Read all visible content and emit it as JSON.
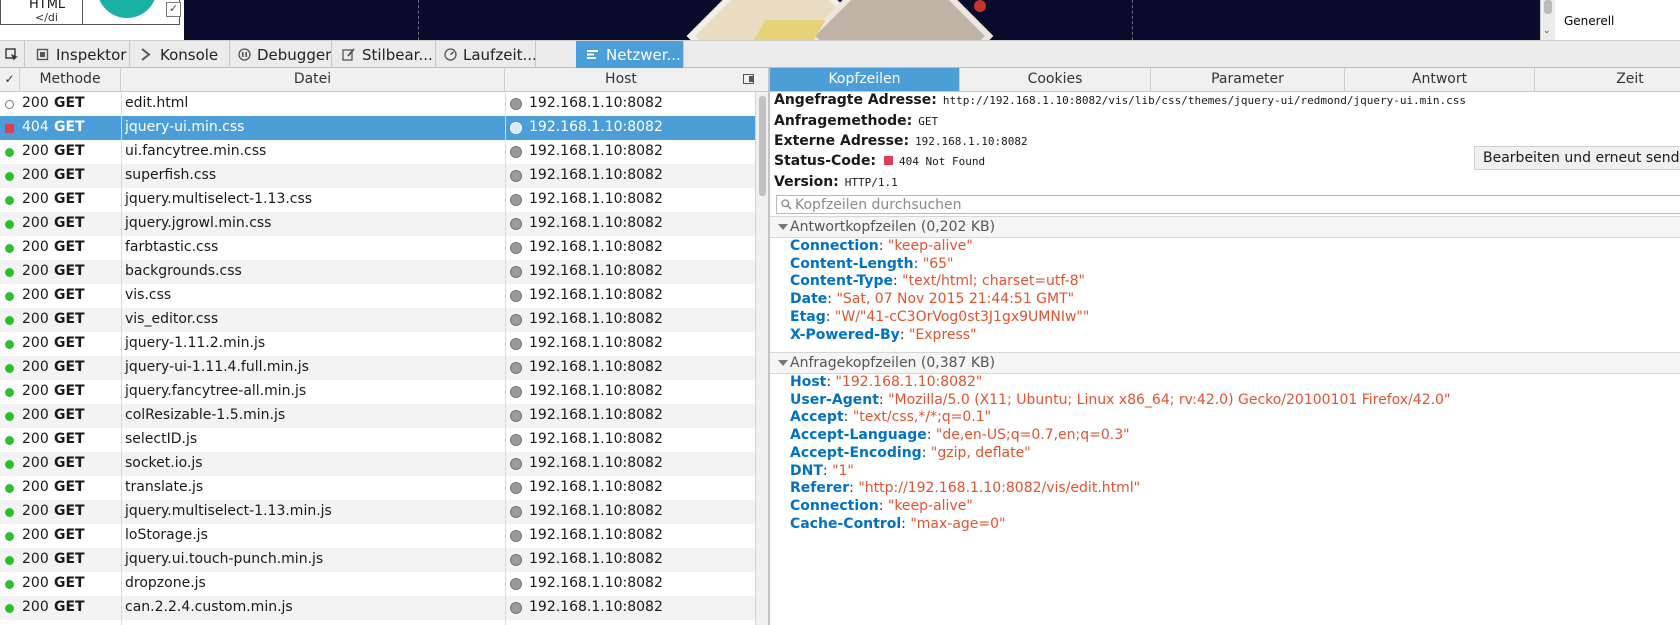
{
  "page_strip": {
    "html_box_line1": "HTML",
    "html_box_line2": "</di",
    "checkbox_mark": "✓",
    "scroll_arrow": "⌄",
    "generell_label": "Generell"
  },
  "toolbar": {
    "tabs": [
      {
        "label": "Inspektor",
        "icon": "inspector-icon"
      },
      {
        "label": "Konsole",
        "icon": "console-icon"
      },
      {
        "label": "Debugger",
        "icon": "debugger-icon"
      },
      {
        "label": "Stilbear...",
        "icon": "style-editor-icon"
      },
      {
        "label": "Laufzeit...",
        "icon": "performance-icon"
      },
      {
        "label": "Netzwer...",
        "icon": "network-icon"
      }
    ],
    "active_tab": "Netzwer..."
  },
  "requests": {
    "columns": {
      "check": "✓",
      "method": "Methode",
      "file": "Datei",
      "host": "Host"
    },
    "rows": [
      {
        "status": "200",
        "method": "GET",
        "file": "edit.html",
        "host": "192.168.1.10:8082",
        "state": "pending"
      },
      {
        "status": "404",
        "method": "GET",
        "file": "jquery-ui.min.css",
        "host": "192.168.1.10:8082",
        "state": "error"
      },
      {
        "status": "200",
        "method": "GET",
        "file": "ui.fancytree.min.css",
        "host": "192.168.1.10:8082",
        "state": "ok"
      },
      {
        "status": "200",
        "method": "GET",
        "file": "superfish.css",
        "host": "192.168.1.10:8082",
        "state": "ok"
      },
      {
        "status": "200",
        "method": "GET",
        "file": "jquery.multiselect-1.13.css",
        "host": "192.168.1.10:8082",
        "state": "ok"
      },
      {
        "status": "200",
        "method": "GET",
        "file": "jquery.jgrowl.min.css",
        "host": "192.168.1.10:8082",
        "state": "ok"
      },
      {
        "status": "200",
        "method": "GET",
        "file": "farbtastic.css",
        "host": "192.168.1.10:8082",
        "state": "ok"
      },
      {
        "status": "200",
        "method": "GET",
        "file": "backgrounds.css",
        "host": "192.168.1.10:8082",
        "state": "ok"
      },
      {
        "status": "200",
        "method": "GET",
        "file": "vis.css",
        "host": "192.168.1.10:8082",
        "state": "ok"
      },
      {
        "status": "200",
        "method": "GET",
        "file": "vis_editor.css",
        "host": "192.168.1.10:8082",
        "state": "ok"
      },
      {
        "status": "200",
        "method": "GET",
        "file": "jquery-1.11.2.min.js",
        "host": "192.168.1.10:8082",
        "state": "ok"
      },
      {
        "status": "200",
        "method": "GET",
        "file": "jquery-ui-1.11.4.full.min.js",
        "host": "192.168.1.10:8082",
        "state": "ok"
      },
      {
        "status": "200",
        "method": "GET",
        "file": "jquery.fancytree-all.min.js",
        "host": "192.168.1.10:8082",
        "state": "ok"
      },
      {
        "status": "200",
        "method": "GET",
        "file": "colResizable-1.5.min.js",
        "host": "192.168.1.10:8082",
        "state": "ok"
      },
      {
        "status": "200",
        "method": "GET",
        "file": "selectID.js",
        "host": "192.168.1.10:8082",
        "state": "ok"
      },
      {
        "status": "200",
        "method": "GET",
        "file": "socket.io.js",
        "host": "192.168.1.10:8082",
        "state": "ok"
      },
      {
        "status": "200",
        "method": "GET",
        "file": "translate.js",
        "host": "192.168.1.10:8082",
        "state": "ok"
      },
      {
        "status": "200",
        "method": "GET",
        "file": "jquery.multiselect-1.13.min.js",
        "host": "192.168.1.10:8082",
        "state": "ok"
      },
      {
        "status": "200",
        "method": "GET",
        "file": "loStorage.js",
        "host": "192.168.1.10:8082",
        "state": "ok"
      },
      {
        "status": "200",
        "method": "GET",
        "file": "jquery.ui.touch-punch.min.js",
        "host": "192.168.1.10:8082",
        "state": "ok"
      },
      {
        "status": "200",
        "method": "GET",
        "file": "dropzone.js",
        "host": "192.168.1.10:8082",
        "state": "ok"
      },
      {
        "status": "200",
        "method": "GET",
        "file": "can.2.2.4.custom.min.js",
        "host": "192.168.1.10:8082",
        "state": "ok"
      }
    ],
    "selected_index": 1
  },
  "details": {
    "tabs": [
      "Kopfzeilen",
      "Cookies",
      "Parameter",
      "Antwort",
      "Zeit"
    ],
    "active_tab": "Kopfzeilen",
    "summary": {
      "url_label": "Angefragte Adresse:",
      "url_value": "http://192.168.1.10:8082/vis/lib/css/themes/jquery-ui/redmond/jquery-ui.min.css",
      "method_label": "Anfragemethode:",
      "method_value": "GET",
      "remote_label": "Externe Adresse:",
      "remote_value": "192.168.1.10:8082",
      "status_label": "Status-Code:",
      "status_value": "404 Not Found",
      "version_label": "Version:",
      "version_value": "HTTP/1.1"
    },
    "edit_resend_label": "Bearbeiten und erneut senden",
    "filter_placeholder": "Kopfzeilen durchsuchen",
    "response_section": "Antwortkopfzeilen (0,202 KB)",
    "response_headers": [
      {
        "name": "Connection",
        "value": "\"keep-alive\""
      },
      {
        "name": "Content-Length",
        "value": "\"65\""
      },
      {
        "name": "Content-Type",
        "value": "\"text/html; charset=utf-8\""
      },
      {
        "name": "Date",
        "value": "\"Sat, 07 Nov 2015 21:44:51 GMT\""
      },
      {
        "name": "Etag",
        "value": "\"W/\"41-cC3OrVog0st3J1gx9UMNIw\"\""
      },
      {
        "name": "X-Powered-By",
        "value": "\"Express\""
      }
    ],
    "request_section": "Anfragekopfzeilen (0,387 KB)",
    "request_headers": [
      {
        "name": "Host",
        "value": "\"192.168.1.10:8082\""
      },
      {
        "name": "User-Agent",
        "value": "\"Mozilla/5.0 (X11; Ubuntu; Linux x86_64; rv:42.0) Gecko/20100101 Firefox/42.0\""
      },
      {
        "name": "Accept",
        "value": "\"text/css,*/*;q=0.1\""
      },
      {
        "name": "Accept-Language",
        "value": "\"de,en-US;q=0.7,en;q=0.3\""
      },
      {
        "name": "Accept-Encoding",
        "value": "\"gzip, deflate\""
      },
      {
        "name": "DNT",
        "value": "\"1\""
      },
      {
        "name": "Referer",
        "value": "\"http://192.168.1.10:8082/vis/edit.html\""
      },
      {
        "name": "Connection",
        "value": "\"keep-alive\""
      },
      {
        "name": "Cache-Control",
        "value": "\"max-age=0\""
      }
    ]
  }
}
